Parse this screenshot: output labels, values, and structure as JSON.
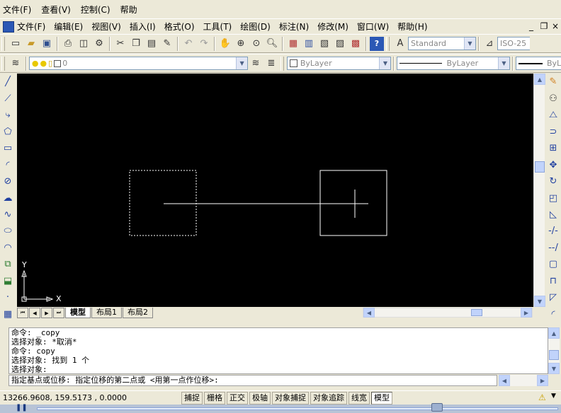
{
  "menubar": [
    "文件(F)",
    "查看(V)",
    "控制(C)",
    "帮助"
  ],
  "acad_menu": [
    "文件(F)",
    "编辑(E)",
    "视图(V)",
    "插入(I)",
    "格式(O)",
    "工具(T)",
    "绘图(D)",
    "标注(N)",
    "修改(M)",
    "窗口(W)",
    "帮助(H)"
  ],
  "window_controls": [
    "_",
    "❐",
    "×"
  ],
  "standard_toolbar": {
    "icons": [
      "new-icon",
      "open-icon",
      "save-icon",
      "print-icon",
      "preview-icon",
      "publish-icon",
      "cut-icon",
      "copy-icon",
      "paste-icon",
      "match-icon",
      "undo-icon",
      "redo-icon",
      "pan-icon",
      "zoom-realtime-icon",
      "zoom-window-icon",
      "zoom-previous-icon",
      "properties-icon",
      "designcenter-icon",
      "toolpalette-icon",
      "sheetset-icon",
      "markup-icon",
      "help-icon"
    ],
    "text_style": "Standard",
    "dim_style": "ISO-25"
  },
  "layers_toolbar": {
    "layer_value": "0",
    "color": "ByLayer",
    "linetype": "ByLayer",
    "lineweight": "ByLay"
  },
  "left_tools": [
    "line-icon",
    "construction-line-icon",
    "polyline-icon",
    "polygon-icon",
    "rectangle-icon",
    "arc-icon",
    "circle-icon",
    "revcloud-icon",
    "spline-icon",
    "ellipse-icon",
    "ellipse-arc-icon",
    "insert-block-icon",
    "make-block-icon",
    "point-icon",
    "hatch-icon"
  ],
  "right_tools": [
    "erase-icon",
    "copy-object-icon",
    "mirror-icon",
    "offset-icon",
    "array-icon",
    "move-icon",
    "rotate-icon",
    "scale-icon",
    "stretch-icon",
    "trim-icon",
    "extend-icon",
    "break-icon",
    "join-icon",
    "chamfer-icon",
    "fillet-icon"
  ],
  "ucs": {
    "x": "X",
    "y": "Y"
  },
  "tabs": [
    "模型",
    "布局1",
    "布局2"
  ],
  "command_history": [
    "命令: _copy",
    "选择对象: *取消*",
    "命令: copy",
    "选择对象: 找到 1 个",
    "选择对象:"
  ],
  "command_prompt": "指定基点或位移: 指定位移的第二点或 <用第一点作位移>:",
  "status": {
    "coords": "13266.9608, 159.5173 , 0.0000",
    "buttons": [
      "捕捉",
      "栅格",
      "正交",
      "极轴",
      "对象捕捉",
      "对象追踪",
      "线宽",
      "模型"
    ]
  },
  "colors": {
    "canvas": "#000000",
    "drawing": "#FFFFFF",
    "chrome": "#ECE9D8"
  }
}
